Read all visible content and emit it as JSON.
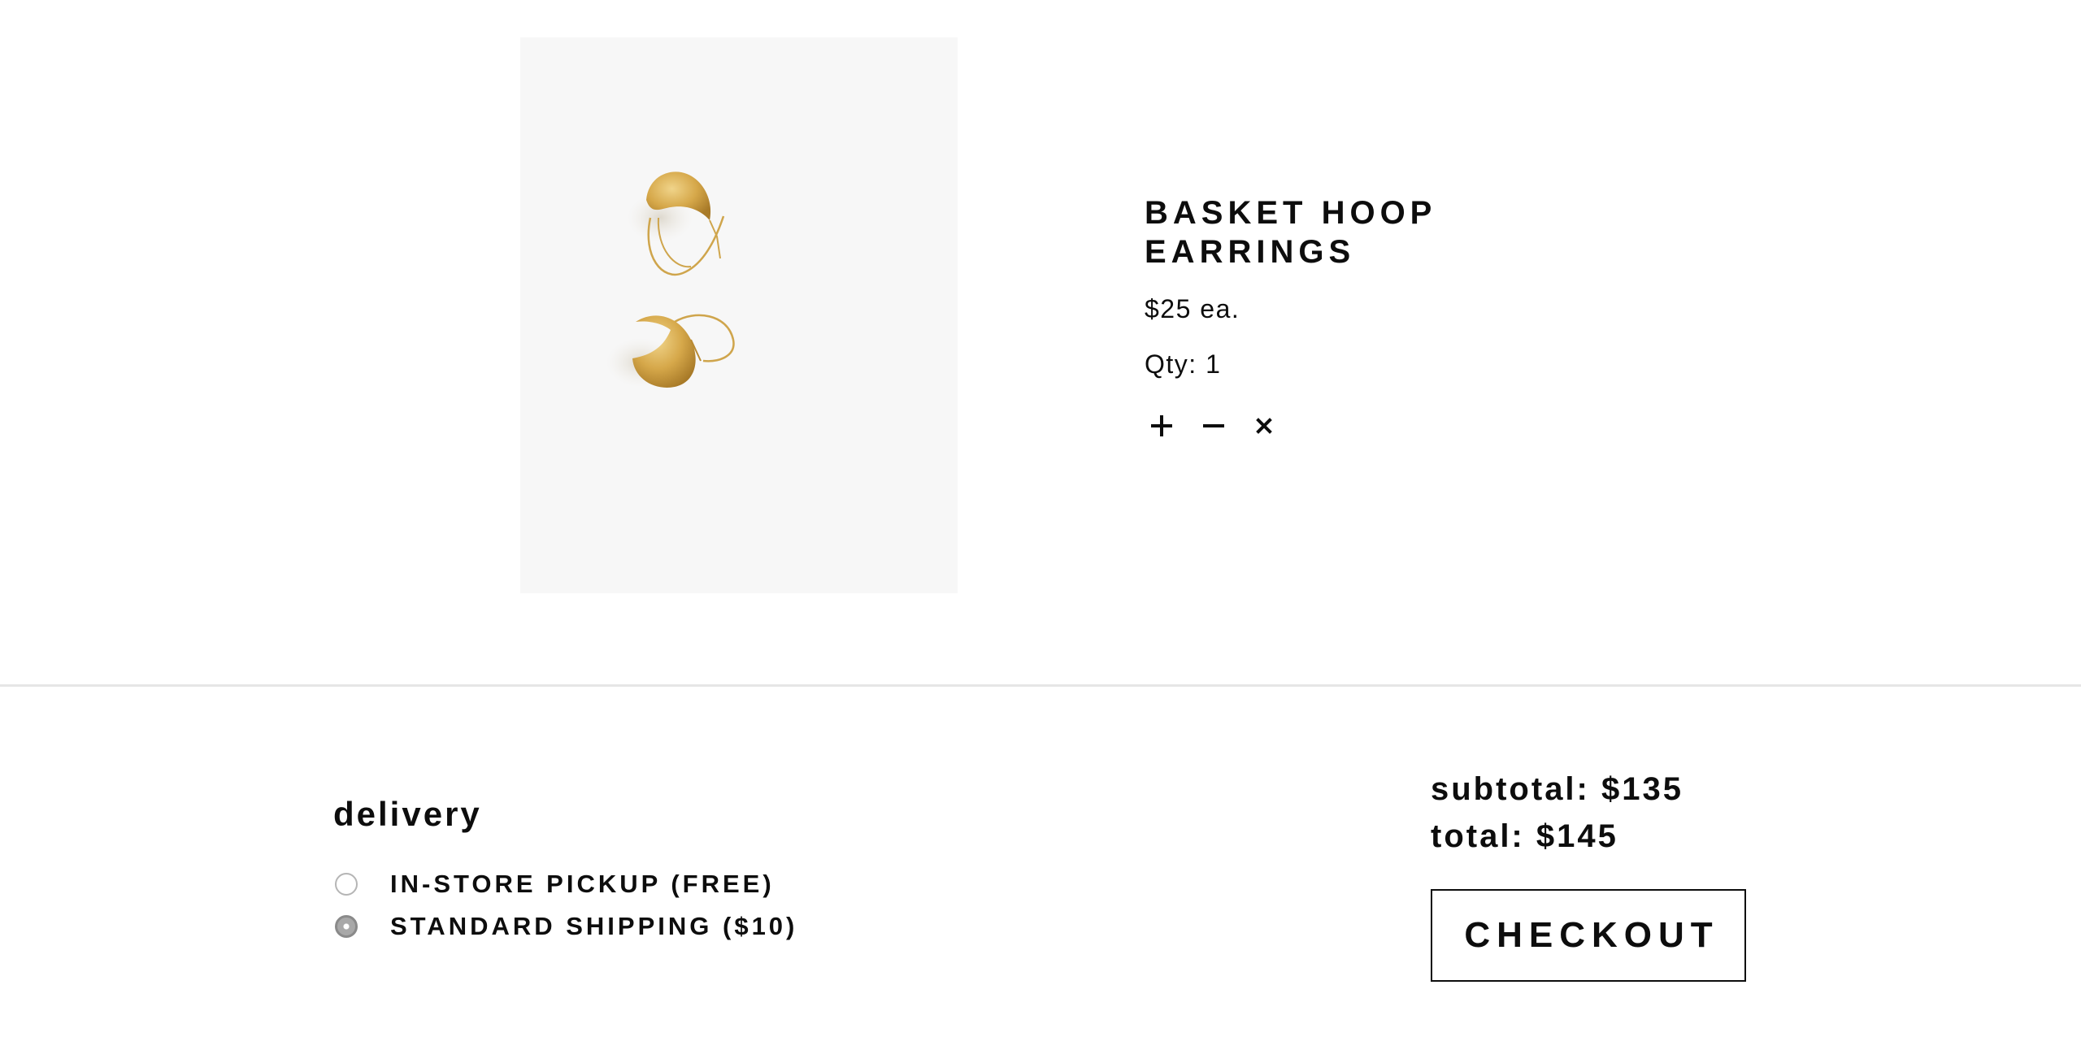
{
  "product": {
    "image_alt": "Basket Hoop Earrings product photo",
    "title": "BASKET HOOP EARRINGS",
    "price": "$25 ea.",
    "quantity_text": "Qty: 1",
    "controls": {
      "increase_icon": "plus-icon",
      "decrease_icon": "minus-icon",
      "remove_icon": "close-icon"
    }
  },
  "delivery": {
    "heading": "delivery",
    "options": [
      {
        "label": "IN-STORE PICKUP (FREE)",
        "selected": false
      },
      {
        "label": "STANDARD SHIPPING ($10)",
        "selected": true
      }
    ]
  },
  "summary": {
    "subtotal": "subtotal: $135",
    "total": "total: $145",
    "checkout_label": "CHECKOUT"
  },
  "colors": {
    "text": "#0d0d0d",
    "image_background": "#f7f7f7",
    "divider": "#e6e6e6",
    "gold": "#d4a84a"
  }
}
